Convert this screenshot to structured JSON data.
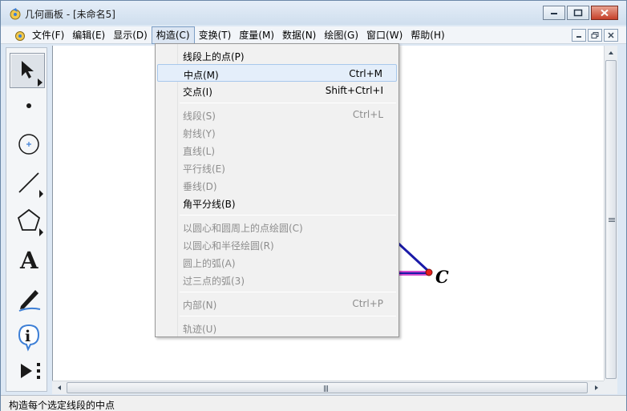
{
  "window": {
    "title": "几何画板 - [未命名5]"
  },
  "menubar": {
    "items": [
      {
        "label": "文件(F)"
      },
      {
        "label": "编辑(E)"
      },
      {
        "label": "显示(D)"
      },
      {
        "label": "构造(C)",
        "active": true
      },
      {
        "label": "变换(T)"
      },
      {
        "label": "度量(M)"
      },
      {
        "label": "数据(N)"
      },
      {
        "label": "绘图(G)"
      },
      {
        "label": "窗口(W)"
      },
      {
        "label": "帮助(H)"
      }
    ]
  },
  "toolbox": {
    "tools": [
      {
        "name": "arrow-tool",
        "icon": "arrow-select-icon",
        "selected": true
      },
      {
        "name": "point-tool",
        "icon": "point-icon"
      },
      {
        "name": "compass-tool",
        "icon": "circle-compass-icon"
      },
      {
        "name": "straightedge-tool",
        "icon": "segment-icon"
      },
      {
        "name": "polygon-tool",
        "icon": "pentagon-icon"
      },
      {
        "name": "text-tool",
        "icon": "text-a-icon",
        "glyph": "A"
      },
      {
        "name": "marker-tool",
        "icon": "marker-pen-icon"
      },
      {
        "name": "info-tool",
        "icon": "info-icon",
        "glyph": "i"
      },
      {
        "name": "custom-tool",
        "icon": "custom-play-icon"
      }
    ]
  },
  "construct_menu": {
    "items": [
      {
        "label": "线段上的点(P)",
        "shortcut": "",
        "enabled": true
      },
      {
        "label": "中点(M)",
        "shortcut": "Ctrl+M",
        "enabled": true,
        "highlighted": true
      },
      {
        "label": "交点(I)",
        "shortcut": "Shift+Ctrl+I",
        "enabled": true
      },
      {
        "label": "线段(S)",
        "shortcut": "Ctrl+L",
        "enabled": false
      },
      {
        "label": "射线(Y)",
        "shortcut": "",
        "enabled": false
      },
      {
        "label": "直线(L)",
        "shortcut": "",
        "enabled": false
      },
      {
        "label": "平行线(E)",
        "shortcut": "",
        "enabled": false
      },
      {
        "label": "垂线(D)",
        "shortcut": "",
        "enabled": false
      },
      {
        "label": "角平分线(B)",
        "shortcut": "",
        "enabled": true
      },
      {
        "label": "以圆心和圆周上的点绘圆(C)",
        "shortcut": "",
        "enabled": false
      },
      {
        "label": "以圆心和半径绘圆(R)",
        "shortcut": "",
        "enabled": false
      },
      {
        "label": "圆上的弧(A)",
        "shortcut": "",
        "enabled": false
      },
      {
        "label": "过三点的弧(3)",
        "shortcut": "",
        "enabled": false
      },
      {
        "label": "内部(N)",
        "shortcut": "Ctrl+P",
        "enabled": false
      },
      {
        "label": "轨迹(U)",
        "shortcut": "",
        "enabled": false
      }
    ]
  },
  "canvas": {
    "point_label": "C",
    "colors": {
      "segment": "#1a1aa8",
      "selected_segment": "#d24ccf",
      "point": "#e8201c"
    }
  },
  "statusbar": {
    "text": "构造每个选定线段的中点"
  }
}
